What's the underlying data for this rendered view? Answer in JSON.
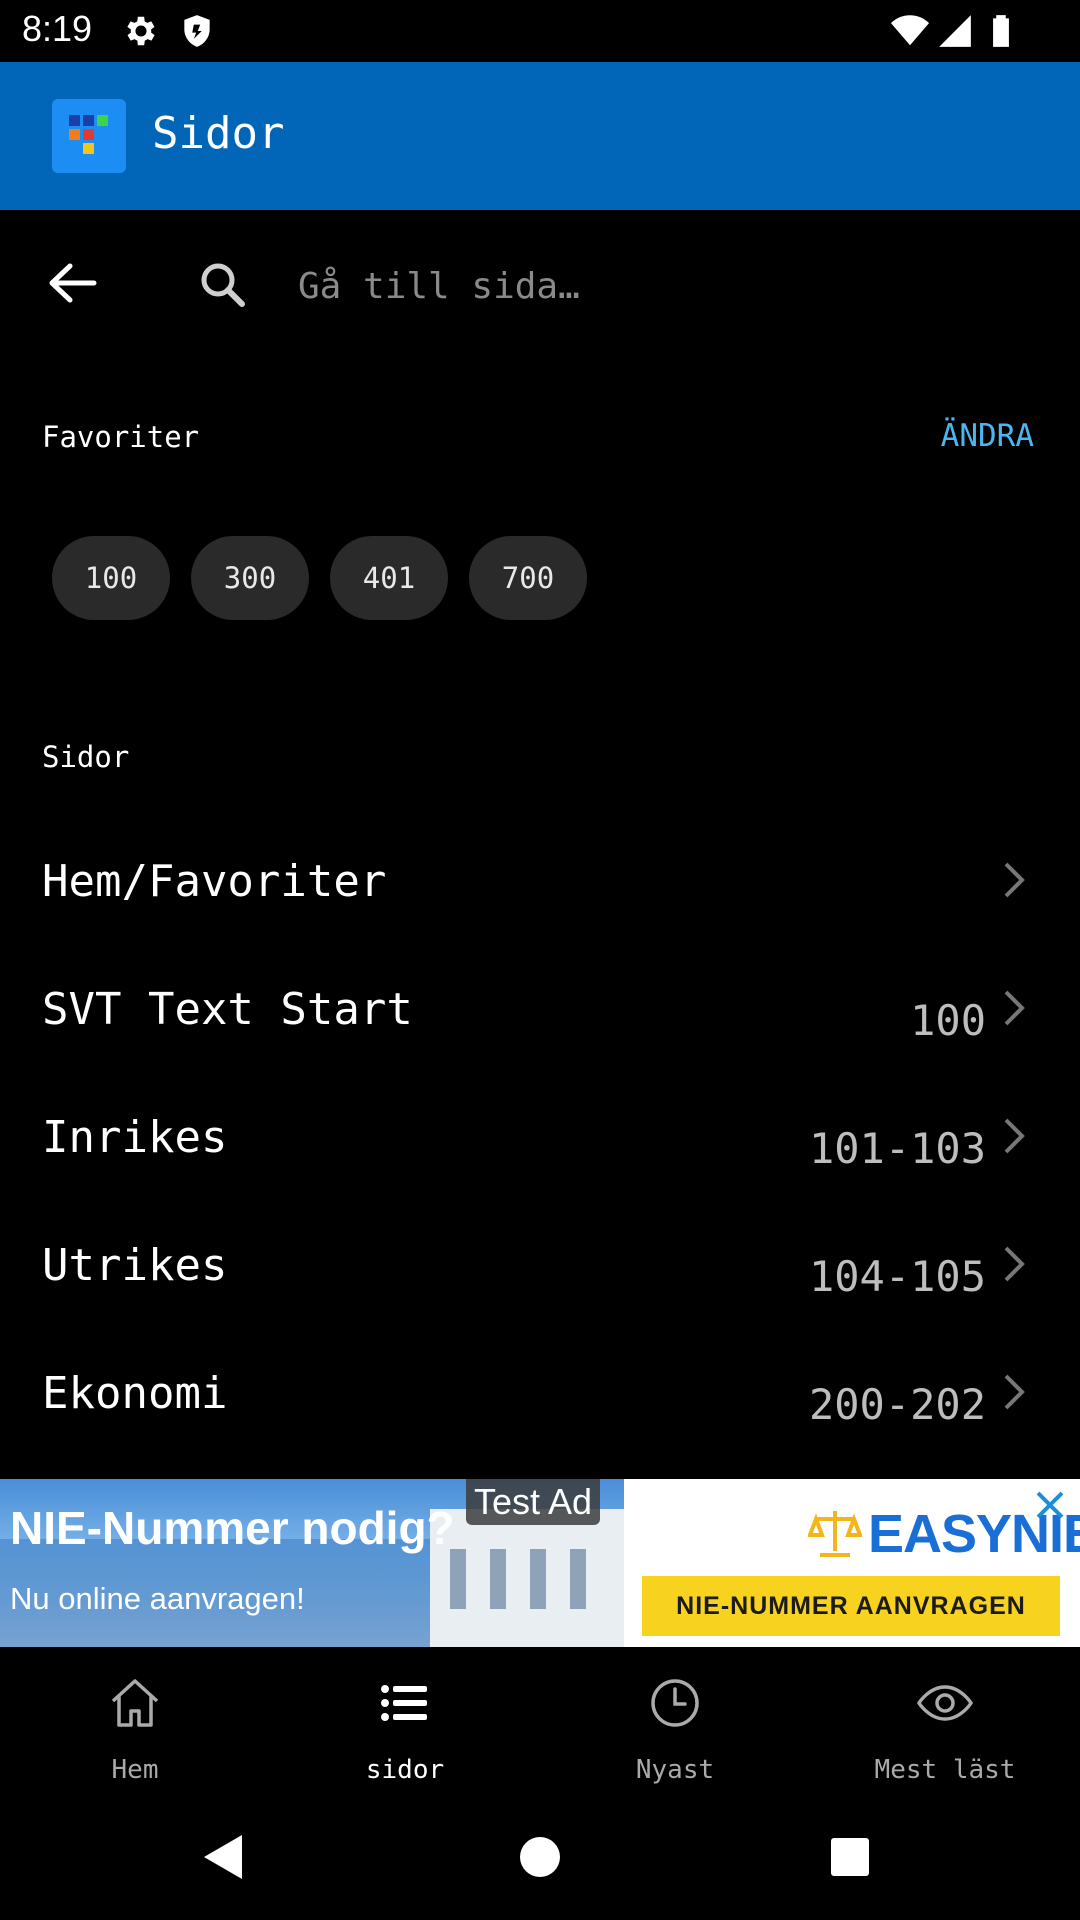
{
  "status_bar": {
    "time": "8:19"
  },
  "app_bar": {
    "title": "Sidor"
  },
  "search": {
    "placeholder": "Gå till sida…"
  },
  "favorites": {
    "label": "Favoriter",
    "edit_label": "ÄNDRA",
    "chips": [
      "100",
      "300",
      "401",
      "700"
    ]
  },
  "pages": {
    "label": "Sidor",
    "rows": [
      {
        "title": "Hem/Favoriter",
        "range": ""
      },
      {
        "title": "SVT Text Start",
        "range": "100"
      },
      {
        "title": "Inrikes",
        "range": "101-103"
      },
      {
        "title": "Utrikes",
        "range": "104-105"
      },
      {
        "title": "Ekonomi",
        "range": "200-202"
      }
    ]
  },
  "ad": {
    "test_label": "Test Ad",
    "headline": "NIE-Nummer nodig?",
    "subline": "Nu online aanvragen!",
    "brand": "EASYNIE",
    "cta": "NIE-NUMMER AANVRAGEN"
  },
  "bottom_nav": {
    "items": [
      {
        "label": "Hem",
        "icon": "home-icon"
      },
      {
        "label": "sidor",
        "icon": "list-icon"
      },
      {
        "label": "Nyast",
        "icon": "clock-icon"
      },
      {
        "label": "Mest läst",
        "icon": "eye-icon"
      }
    ]
  },
  "colors": {
    "app_bar": "#0266b8",
    "accent": "#4cb6f0",
    "chip_bg": "#2a2a2a",
    "ad_cta": "#f7d21e"
  }
}
